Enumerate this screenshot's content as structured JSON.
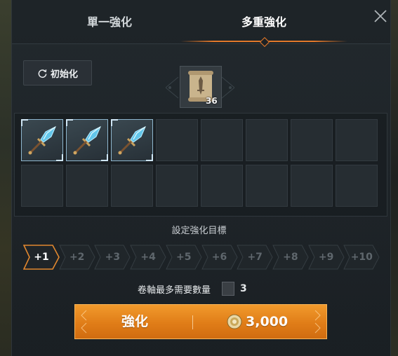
{
  "tabs": [
    {
      "label": "單一強化",
      "active": false
    },
    {
      "label": "多重強化",
      "active": true
    }
  ],
  "reset_button": {
    "label": "初始化",
    "icon": "refresh-icon"
  },
  "scroll_item": {
    "icon": "enhancement-scroll-icon",
    "count": "36"
  },
  "slots": [
    {
      "filled": true,
      "icon": "sword-icon"
    },
    {
      "filled": true,
      "icon": "sword-icon"
    },
    {
      "filled": true,
      "icon": "sword-icon"
    },
    {
      "filled": false
    },
    {
      "filled": false
    },
    {
      "filled": false
    },
    {
      "filled": false
    },
    {
      "filled": false
    },
    {
      "filled": false
    },
    {
      "filled": false
    },
    {
      "filled": false
    },
    {
      "filled": false
    },
    {
      "filled": false
    },
    {
      "filled": false
    },
    {
      "filled": false
    },
    {
      "filled": false
    }
  ],
  "target_label": "設定強化目標",
  "levels": [
    "+1",
    "+2",
    "+3",
    "+4",
    "+5",
    "+6",
    "+7",
    "+8",
    "+9",
    "+10"
  ],
  "selected_level": "+1",
  "requirement": {
    "label": "卷軸最多需要數量",
    "count": "3"
  },
  "enhance_button": {
    "label": "強化",
    "cost": "3,000"
  },
  "colors": {
    "accent": "#e2782a",
    "slot_border_selected": "#8fb7cf",
    "button": "#e8861f"
  }
}
